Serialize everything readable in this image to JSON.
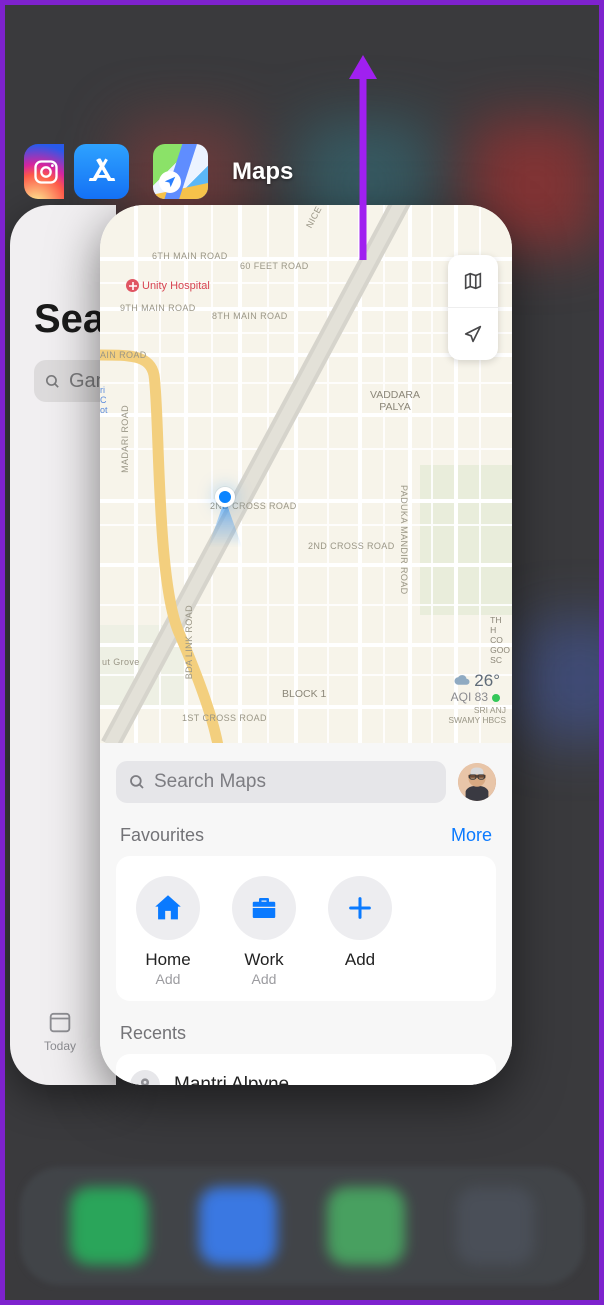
{
  "switcher": {
    "apps": {
      "instagram": "Instagram",
      "appstore": "App Store",
      "maps": "Maps"
    },
    "maps_title": "Maps"
  },
  "appstore_card": {
    "page_title": "Search",
    "search_value": "Games",
    "tab_today": "Today"
  },
  "maps_card": {
    "labels": {
      "sixth_main": "6TH MAIN ROAD",
      "sixty_feet": "60 FEET ROAD",
      "ninth_main": "9TH MAIN ROAD",
      "eighth_main": "8TH MAIN ROAD",
      "main_road": "AIN ROAD",
      "madari": "MADARI ROAD",
      "ut_grove": "ut Grove",
      "bda_link": "BDA LINK ROAD",
      "first_cross": "1ST CROSS ROAD",
      "second_cross_l": "2ND CROSS ROAD",
      "second_cross_r": "2ND CROSS ROAD",
      "paduka": "PADUKA MANDIR ROAD",
      "nice_expwy": "NICE BANGALORE MYSORE EXP",
      "block1": "BLOCK 1"
    },
    "places": {
      "unity_hospital": "Unity Hospital",
      "vaddara": "VADDARA PALYA",
      "the_h": "TH H CO GOO SC",
      "sri_anj": "SRI ANJ SWAMY HBCS",
      "bmtc": "ri C ot"
    },
    "weather": {
      "temp": "26°",
      "aqi_label": "AQI",
      "aqi_value": "83"
    },
    "sheet": {
      "search_placeholder": "Search Maps",
      "favourites": "Favourites",
      "more": "More",
      "home": "Home",
      "home_sub": "Add",
      "work": "Work",
      "work_sub": "Add",
      "add": "Add",
      "recents": "Recents",
      "recent_item": "Mantri Alpyne"
    }
  }
}
